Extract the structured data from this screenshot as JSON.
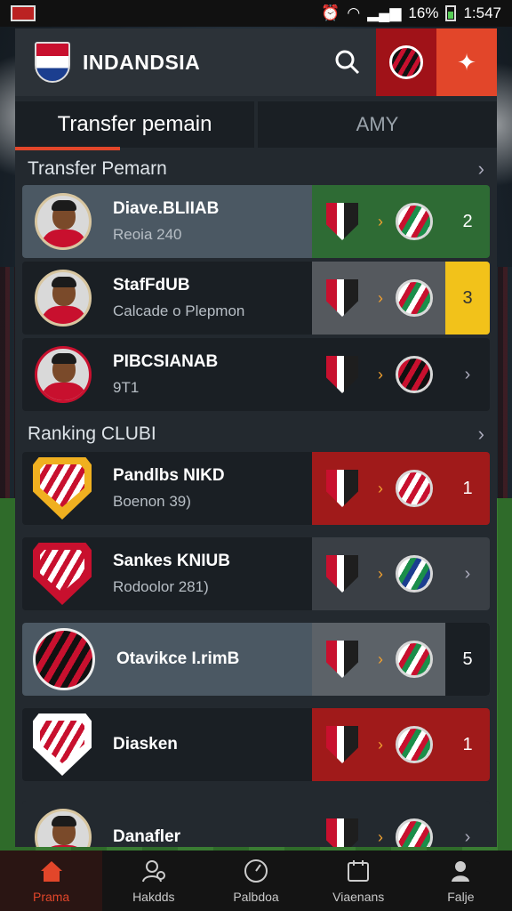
{
  "status_bar": {
    "battery": "16%",
    "time": "1:547"
  },
  "header": {
    "title": "INDANDSIA"
  },
  "tabs": [
    {
      "label": "Transfer pemain"
    },
    {
      "label": "AMY"
    }
  ],
  "sections": {
    "transfers": {
      "title": "Transfer Pemarn"
    },
    "ranking": {
      "title": "Ranking CLUBI"
    }
  },
  "transfers": [
    {
      "name": "Diave.BLIIAB",
      "sub": "Reoia 240",
      "rank": "2",
      "accent": "#2e6b34"
    },
    {
      "name": "StafFdUB",
      "sub": "Calcade o Plepmon",
      "rank": "3",
      "accent": "#f2c21a"
    },
    {
      "name": "PIBCSIANAB",
      "sub": "9T1",
      "rank": "",
      "accent": "#23292f"
    }
  ],
  "ranking": [
    {
      "name": "Pandlbs NIKD",
      "sub": "Boenon 39)",
      "rank": "1",
      "accent": "#a01a1a"
    },
    {
      "name": "Sankes KNIUB",
      "sub": "Rodoolor 281)",
      "rank": "",
      "accent": "#3a3f45"
    },
    {
      "name": "Otavikce I.rimB",
      "sub": "",
      "rank": "5",
      "accent": "#1a1f24"
    },
    {
      "name": "Diasken",
      "sub": "",
      "rank": "1",
      "accent": "#a01a1a"
    },
    {
      "name": "Danafler",
      "sub": "",
      "rank": "",
      "accent": "#23292f"
    }
  ],
  "nav": [
    {
      "label": "Prama",
      "icon": "home-icon"
    },
    {
      "label": "Hakdds",
      "icon": "user-search-icon"
    },
    {
      "label": "Palbdoa",
      "icon": "compass-icon"
    },
    {
      "label": "Viaenans",
      "icon": "calendar-icon"
    },
    {
      "label": "Falje",
      "icon": "profile-icon"
    }
  ],
  "colors": {
    "accent": "#e2462a",
    "brand_red": "#c8102e"
  }
}
